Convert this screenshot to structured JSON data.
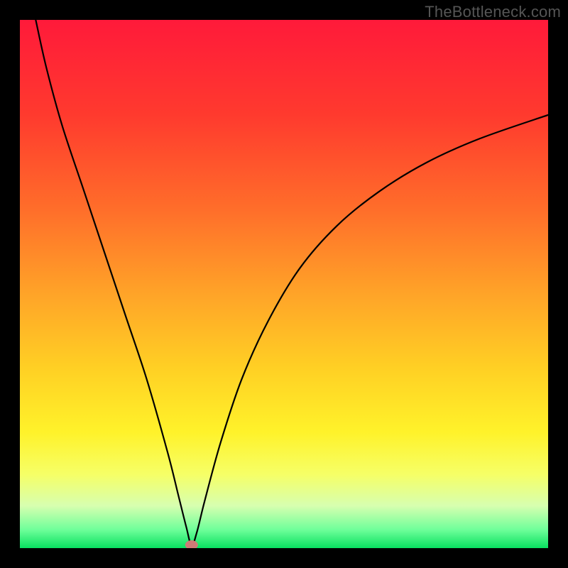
{
  "watermark": "TheBottleneck.com",
  "chart_data": {
    "type": "line",
    "title": "",
    "xlabel": "",
    "ylabel": "",
    "xlim": [
      0,
      100
    ],
    "ylim": [
      0,
      100
    ],
    "grid": false,
    "legend": false,
    "background_gradient": {
      "stops": [
        {
          "offset": 0.0,
          "color": "#ff1a3a"
        },
        {
          "offset": 0.18,
          "color": "#ff3a2e"
        },
        {
          "offset": 0.36,
          "color": "#ff6e2a"
        },
        {
          "offset": 0.52,
          "color": "#ffa428"
        },
        {
          "offset": 0.66,
          "color": "#ffd024"
        },
        {
          "offset": 0.78,
          "color": "#fff22a"
        },
        {
          "offset": 0.86,
          "color": "#f6ff66"
        },
        {
          "offset": 0.92,
          "color": "#d7ffb0"
        },
        {
          "offset": 0.965,
          "color": "#6fff9a"
        },
        {
          "offset": 1.0,
          "color": "#08e060"
        }
      ]
    },
    "series": [
      {
        "name": "bottleneck-curve",
        "x": [
          3,
          5,
          8,
          12,
          16,
          20,
          24,
          28,
          30,
          31.5,
          32.5,
          33.5,
          35,
          38,
          42,
          47,
          53,
          60,
          68,
          77,
          87,
          100
        ],
        "y": [
          100,
          91,
          80,
          68,
          56,
          44,
          32,
          18,
          10,
          4,
          0.5,
          3,
          9,
          20,
          32,
          43,
          53,
          61,
          67.5,
          73,
          77.5,
          82
        ]
      }
    ],
    "marker": {
      "name": "optimal-point",
      "x": 32.5,
      "y": 0.6,
      "color": "#cf7a77"
    }
  }
}
